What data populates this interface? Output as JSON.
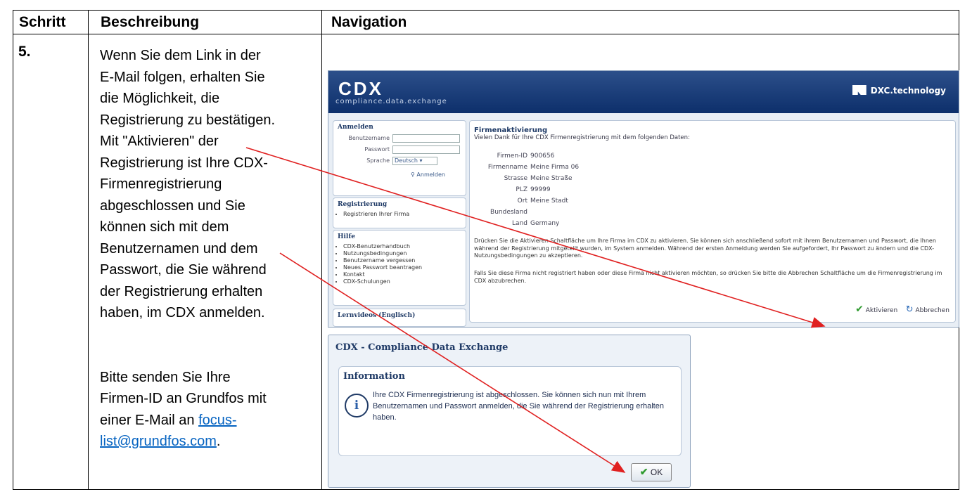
{
  "table": {
    "headers": [
      "Schritt",
      "Beschreibung",
      "Navigation"
    ],
    "step": "5.",
    "description_paragraph1": "Wenn Sie dem Link in der E-Mail folgen, erhalten Sie die Möglichkeit, die Registrierung zu bestätigen. Mit \"Aktivieren\" der Registrierung ist Ihre CDX-Firmenregistrierung abgeschlossen und Sie können sich mit dem Benutzernamen und dem Passwort, die Sie während der Registrierung erhalten haben, im CDX anmelden.",
    "description_paragraph2_text": "Bitte senden Sie Ihre Firmen-ID an Grundfos mit einer E-Mail an ",
    "email_link": "focus-list@grundfos.com",
    "description_paragraph2_end": "."
  },
  "cdx_screen": {
    "logo": "CDX",
    "logo_subtitle": "compliance.data.exchange",
    "brand": "DXC.technology",
    "login": {
      "title": "Anmelden",
      "username_label": "Benutzername",
      "password_label": "Passwort",
      "language_label": "Sprache",
      "language_value": "Deutsch",
      "login_link": "Anmelden"
    },
    "registration": {
      "title": "Registrierung",
      "items": [
        "Registrieren Ihrer Firma"
      ]
    },
    "help": {
      "title": "Hilfe",
      "items": [
        "CDX-Benutzerhandbuch",
        "Nutzungsbedingungen",
        "Benutzername vergessen",
        "Neues Passwort beantragen",
        "Kontakt",
        "CDX-Schulungen"
      ]
    },
    "videos_title": "Lernvideos (Englisch)",
    "activation": {
      "title": "Firmenaktivierung",
      "intro": "Vielen Dank für Ihre CDX Firmenregistrierung mit dem folgenden Daten:",
      "fields": [
        {
          "key": "Firmen-ID",
          "value": "900656"
        },
        {
          "key": "Firmenname",
          "value": "Meine Firma 06"
        },
        {
          "key": "Strasse",
          "value": "Meine Straße"
        },
        {
          "key": "PLZ",
          "value": "99999"
        },
        {
          "key": "Ort",
          "value": "Meine Stadt"
        },
        {
          "key": "Bundesland",
          "value": ""
        },
        {
          "key": "Land",
          "value": "Germany"
        }
      ],
      "para1": "Drücken Sie die Aktivieren Schaltfläche um Ihre Firma im CDX zu aktivieren. Sie können sich anschließend sofort mit ihrem Benutzernamen und Passwort, die Ihnen während der Registrierung mitgeteilt wurden, im System anmelden. Während der ersten Anmeldung werden Sie aufgefordert, Ihr Passwort zu ändern und die CDX-Nutzungsbedingungen zu akzeptieren.",
      "para2": "Falls Sie diese Firma nicht registriert haben oder diese Firma nicht aktivieren möchten, so drücken Sie bitte die Abbrechen Schaltfläche um die Firmenregistrierung im CDX abzubrechen.",
      "activate_label": "Aktivieren",
      "cancel_label": "Abbrechen"
    }
  },
  "dialog": {
    "title": "CDX - Compliance Data Exchange",
    "heading": "Information",
    "message": "Ihre CDX Firmenregistrierung ist abgeschlossen. Sie können sich nun mit Ihrem Benutzernamen und Passwort anmelden, die Sie während der Registrierung erhalten haben.",
    "ok_label": "OK"
  },
  "colors": {
    "arrow": "#e02020",
    "link": "#0563c1",
    "header_blue": "#0d2f6b"
  }
}
